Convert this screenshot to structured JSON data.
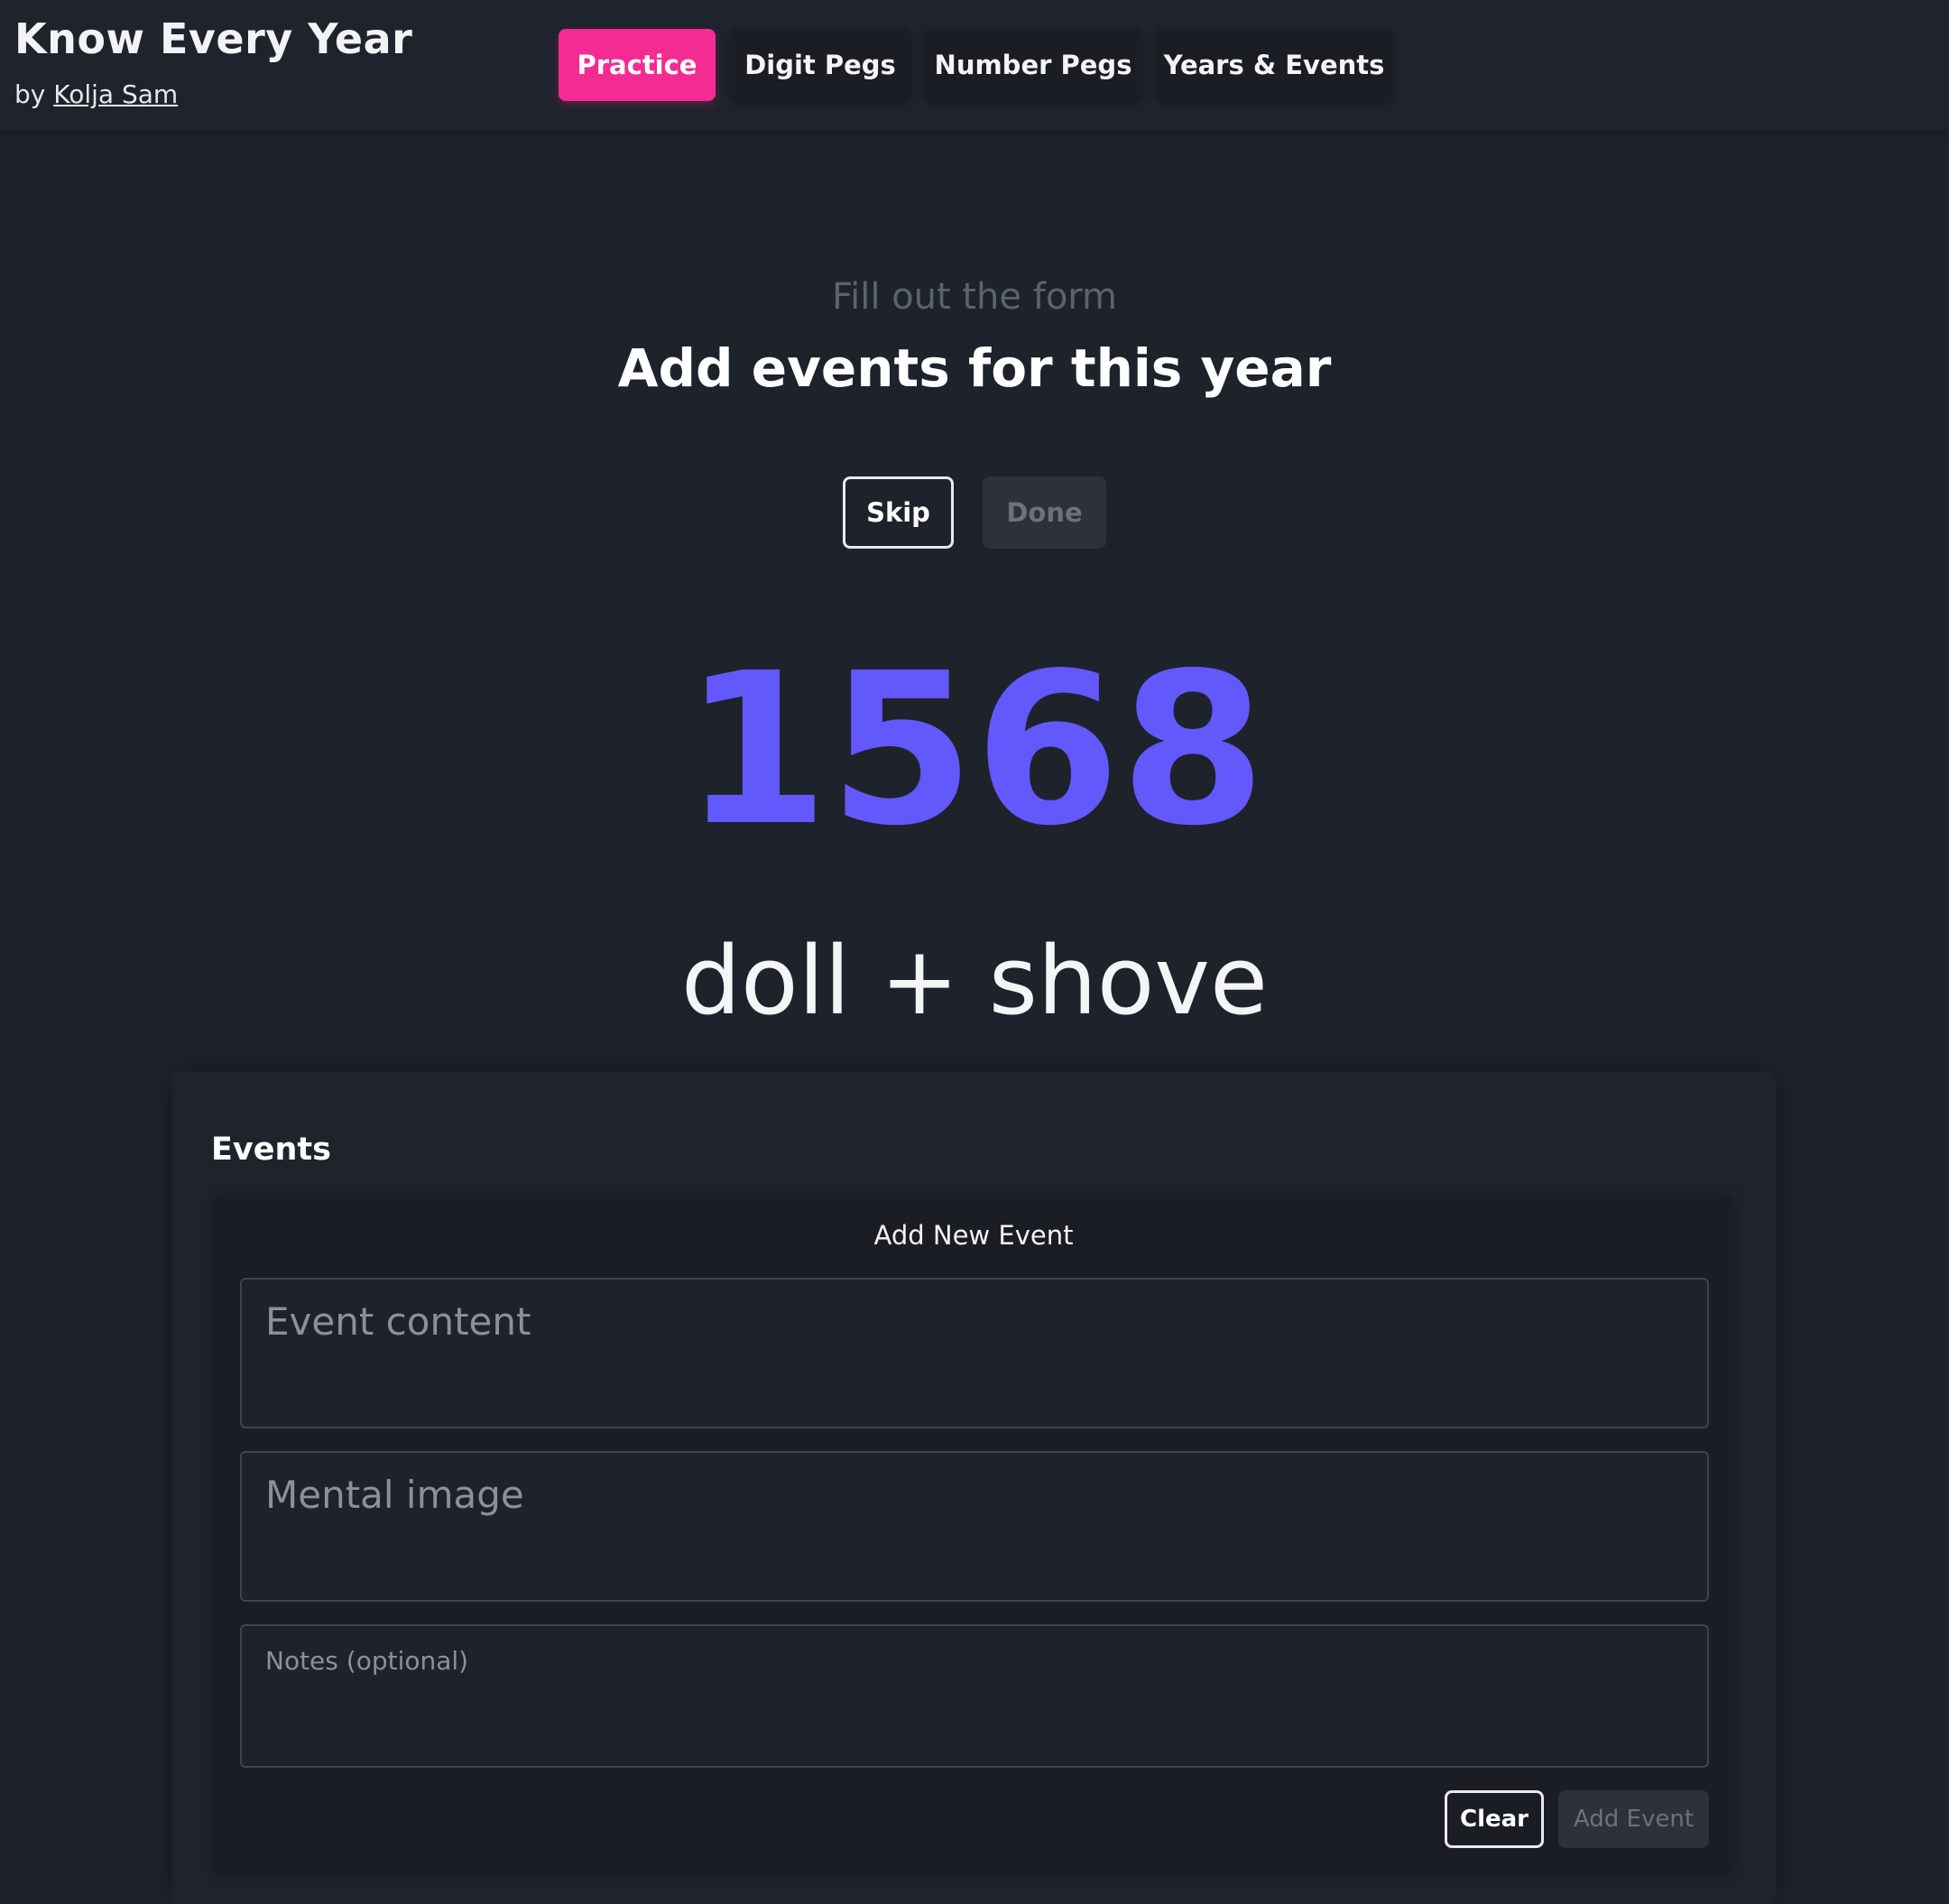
{
  "header": {
    "title": "Know Every Year",
    "by_prefix": "by",
    "author": "Kolja Sam",
    "tabs": [
      {
        "label": "Practice",
        "active": true
      },
      {
        "label": "Digit Pegs",
        "active": false
      },
      {
        "label": "Number Pegs",
        "active": false
      },
      {
        "label": "Years & Events",
        "active": false
      }
    ]
  },
  "main": {
    "subtitle": "Fill out the form",
    "heading": "Add events for this year",
    "skip_label": "Skip",
    "done_label": "Done",
    "year": "1568",
    "mnemonic": "doll + shove"
  },
  "events": {
    "title": "Events",
    "form_title": "Add New Event",
    "content_placeholder": "Event content",
    "image_placeholder": "Mental image",
    "notes_placeholder": "Notes (optional)",
    "clear_label": "Clear",
    "add_label": "Add Event"
  },
  "colors": {
    "background": "#1e222b",
    "accent_pink": "#f42b92",
    "year_purple": "#6358fb"
  }
}
